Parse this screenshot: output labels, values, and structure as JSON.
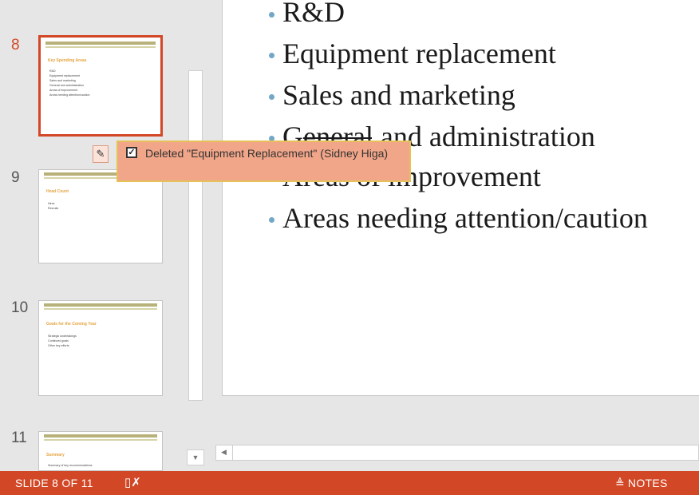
{
  "thumbnails": [
    {
      "number": "8",
      "title": "Key Spending Areas",
      "bullets": [
        "R&D",
        "Equipment replacement",
        "Sales and marketing",
        "General and administration",
        "Areas of improvement",
        "Areas needing attention/caution"
      ]
    },
    {
      "number": "9",
      "title": "Head Count",
      "bullets": [
        "Hires",
        "Recruits"
      ]
    },
    {
      "number": "10",
      "title": "Goals for the Coming Year",
      "bullets": [
        "Strategic undertakings",
        "Continued goals",
        "Other key efforts"
      ]
    },
    {
      "number": "11",
      "title": "Summary",
      "bullets": [
        "Summary of key recommendations"
      ]
    }
  ],
  "slide": {
    "bullets": [
      "R&D",
      "Equipment replacement",
      "Sales and marketing",
      "General and administration",
      "Areas of improvement",
      "Areas needing attention/caution"
    ]
  },
  "revision_tooltip": {
    "text": "Deleted \"Equipment Replacement\" (Sidney Higa)"
  },
  "status_bar": {
    "slide_indicator": "SLIDE 8 OF 11",
    "notes_label": "NOTES"
  },
  "colors": {
    "accent": "#d24726",
    "tooltip_bg": "#f2a689",
    "bullet_dot": "#72a7c7"
  },
  "icons": [
    "revision-marker-icon",
    "checkbox-icon",
    "notes-icon",
    "scroll-down-icon",
    "scroll-left-icon",
    "spellcheck-icon"
  ]
}
